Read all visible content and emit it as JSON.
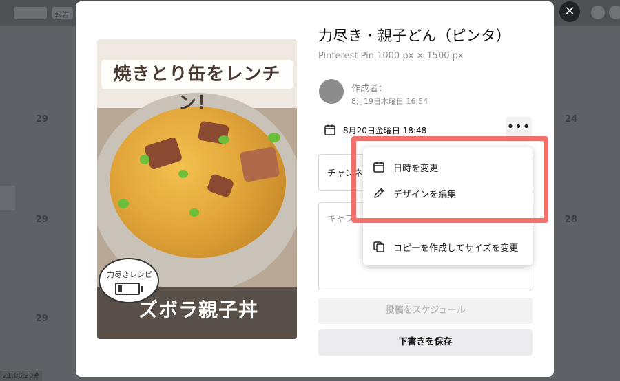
{
  "background": {
    "top_chip_label": "報告",
    "left_numbers": [
      "29",
      "29",
      "29"
    ],
    "right_numbers": [
      "24",
      "28"
    ],
    "bottom_text": "21.08.20#"
  },
  "modal": {
    "title": "力尽き・親子どん（ピンタ）",
    "subtitle": "Pinterest Pin 1000 px × 1500 px",
    "creator_label": "作成者：",
    "creator_date": "8月19日木曜日 16:54",
    "scheduled_date": "8月20日金曜日 18:48",
    "more_label": "•••",
    "channel_placeholder": "チャンネ",
    "caption_placeholder": "キャプ",
    "schedule_button": "投稿をスケジュール",
    "save_draft_button": "下書きを保存"
  },
  "preview": {
    "top_text": "焼きとり缶をレンチン！",
    "badge_text": "力尽きレシピ",
    "bottom_text": "ズボラ親子丼"
  },
  "menu": {
    "items": [
      {
        "label": "日時を変更",
        "icon": "calendar-icon"
      },
      {
        "label": "デザインを編集",
        "icon": "pencil-icon"
      },
      {
        "label": "コピーを作成してサイズを変更",
        "icon": "copy-icon"
      }
    ]
  },
  "colors": {
    "highlight": "#f26f6a",
    "overlay": "#5f6166"
  }
}
